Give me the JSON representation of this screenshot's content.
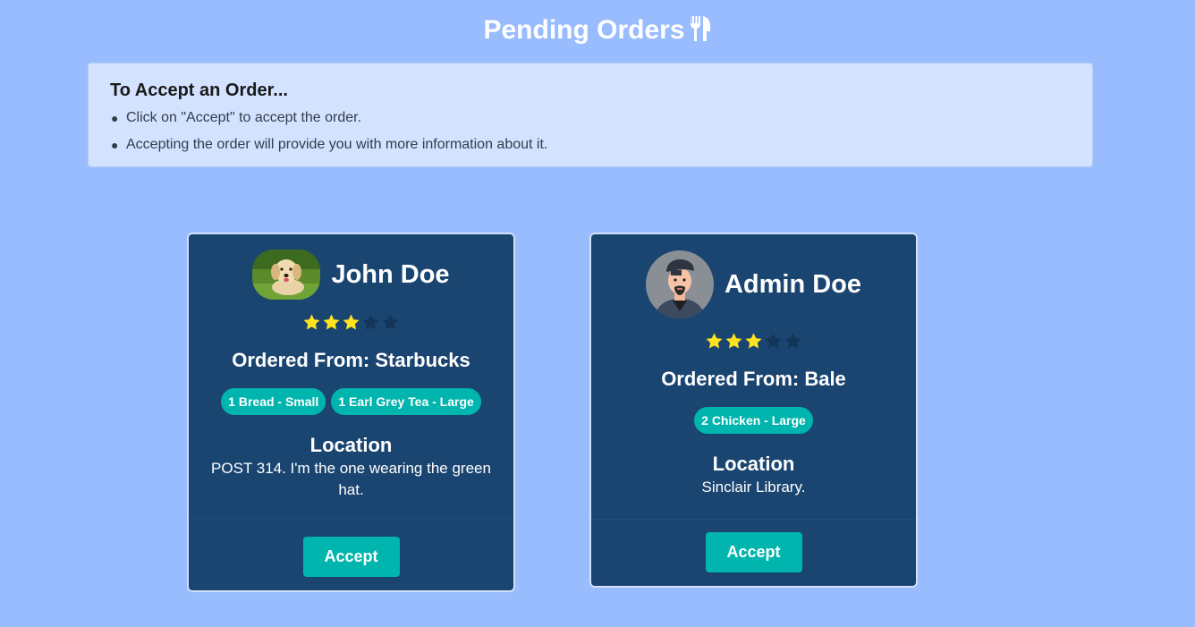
{
  "header": {
    "title": "Pending Orders",
    "icon": "fork-knife-icon"
  },
  "info": {
    "title": "To Accept an Order...",
    "items": [
      "Click on \"Accept\" to accept the order.",
      "Accepting the order will provide you with more information about it."
    ]
  },
  "colors": {
    "background": "#98bcfd",
    "card": "#1a4570",
    "accent": "#00b5ad",
    "star_filled": "#ffe21f",
    "star_empty": "#123558"
  },
  "orders": [
    {
      "name": "John Doe",
      "avatar": "dog-avatar",
      "rating": 3,
      "rating_max": 5,
      "ordered_from": "Ordered From: Starbucks",
      "items": [
        "1 Bread - Small",
        "1 Earl Grey Tea - Large"
      ],
      "location_label": "Location",
      "location": "POST 314. I'm the one wearing the green hat.",
      "accept_label": "Accept"
    },
    {
      "name": "Admin Doe",
      "avatar": "man-avatar",
      "rating": 3,
      "rating_max": 5,
      "ordered_from": "Ordered From: Bale",
      "items": [
        "2 Chicken - Large"
      ],
      "location_label": "Location",
      "location": "Sinclair Library.",
      "accept_label": "Accept"
    }
  ]
}
